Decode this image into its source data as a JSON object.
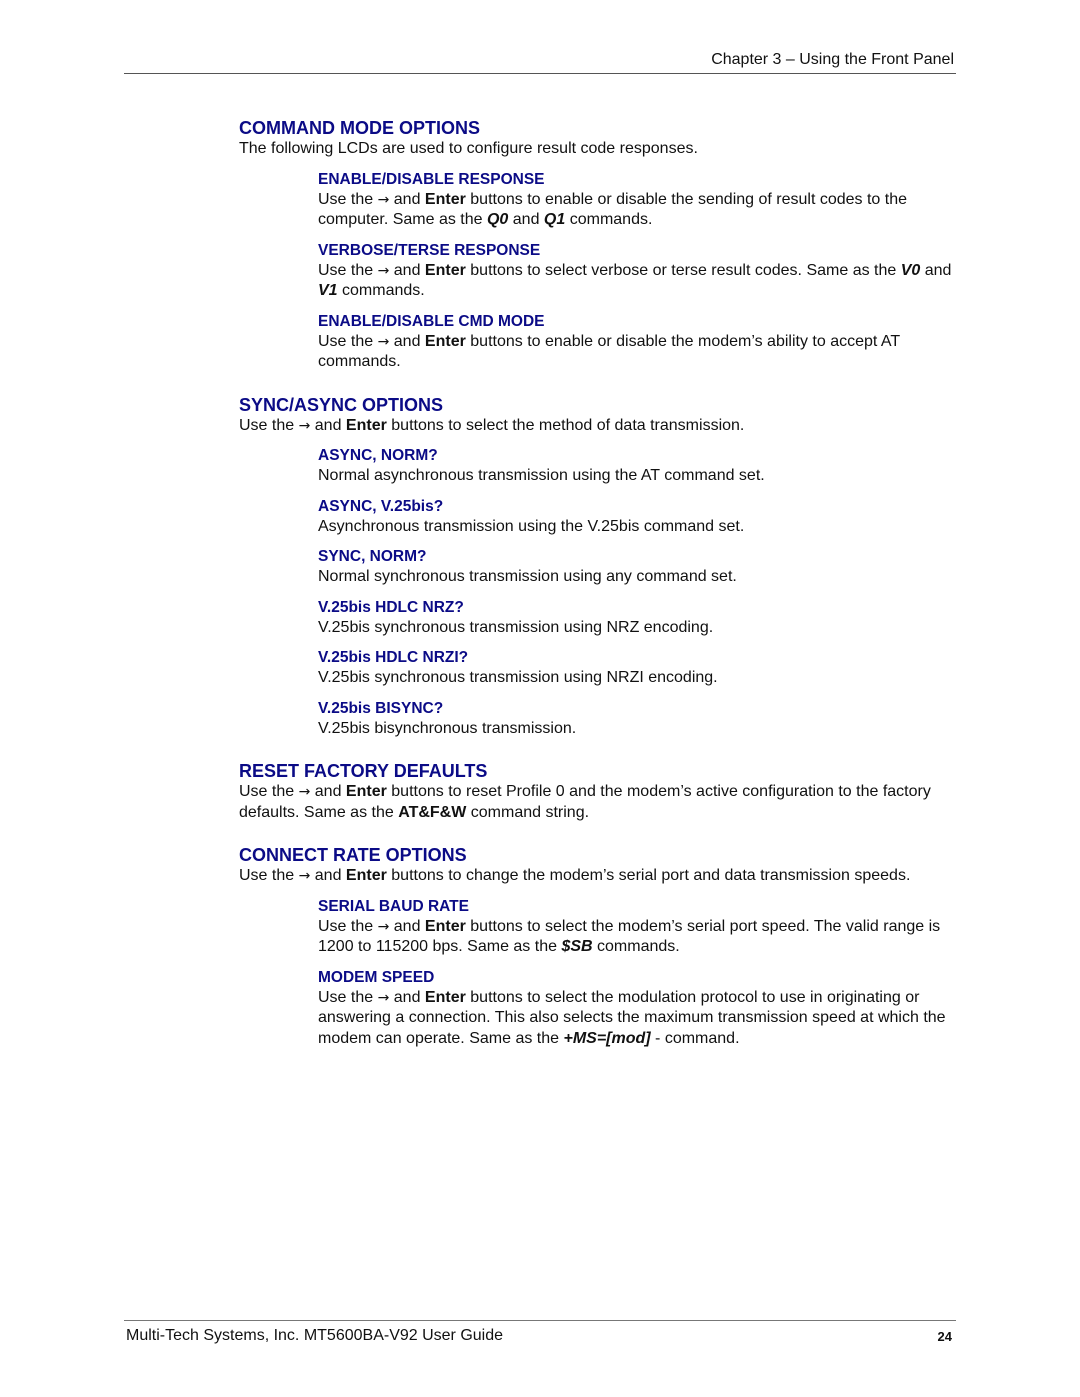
{
  "header": {
    "chapter": "Chapter 3 – Using the Front Panel"
  },
  "sections": {
    "command_mode": {
      "title": "COMMAND MODE OPTIONS",
      "intro": "The following LCDs are used to configure result code responses.",
      "items": [
        {
          "title": "ENABLE/DISABLE RESPONSE",
          "pre": "Use the ",
          "arrow": "→",
          "mid": " and ",
          "bold": "Enter",
          "post": " buttons to enable or disable the sending of result codes to the computer. Same as the ",
          "cmd1": "Q0",
          "and": " and ",
          "cmd2": "Q1",
          "end": " commands."
        },
        {
          "title": "VERBOSE/TERSE RESPONSE",
          "pre": "Use the ",
          "arrow": "→",
          "mid": " and ",
          "bold": "Enter",
          "post": " buttons to select verbose or terse result codes. Same as the ",
          "cmd1": "V0",
          "and": " and ",
          "cmd2": "V1",
          "end": " commands."
        },
        {
          "title": "ENABLE/DISABLE CMD MODE",
          "pre": "Use the ",
          "arrow": "→",
          "mid": " and ",
          "bold": "Enter",
          "post": " buttons to enable or disable the modem’s ability to accept AT commands."
        }
      ]
    },
    "sync_async": {
      "title": "SYNC/ASYNC OPTIONS",
      "pre": "Use the ",
      "arrow": "→",
      "mid": " and ",
      "bold": "Enter",
      "post": " buttons to select the method of data transmission.",
      "items": [
        {
          "title": "ASYNC, NORM?",
          "text": "Normal asynchronous transmission using the AT command set."
        },
        {
          "title": "ASYNC, V.25bis?",
          "text": "Asynchronous transmission using the V.25bis command set."
        },
        {
          "title": "SYNC, NORM?",
          "text": "Normal synchronous transmission using any command set."
        },
        {
          "title": "V.25bis HDLC NRZ?",
          "text": "V.25bis synchronous transmission using NRZ encoding."
        },
        {
          "title": "V.25bis HDLC NRZI?",
          "text": "V.25bis synchronous transmission using NRZI encoding."
        },
        {
          "title": "V.25bis BISYNC?",
          "text": "V.25bis bisynchronous transmission."
        }
      ]
    },
    "reset": {
      "title": "RESET FACTORY DEFAULTS",
      "pre": "Use the ",
      "arrow": "→",
      "mid": " and ",
      "bold": "Enter",
      "post": " buttons to reset Profile 0 and the modem’s active configuration to the factory defaults. Same as the ",
      "cmd": "AT&F&W",
      "end": " command string."
    },
    "connect_rate": {
      "title": "CONNECT RATE OPTIONS",
      "pre": "Use the ",
      "arrow": "→",
      "mid": " and ",
      "bold": "Enter",
      "post": " buttons to change the modem’s serial port and data transmission speeds.",
      "items": [
        {
          "title": "SERIAL BAUD RATE",
          "pre": "Use the ",
          "arrow": "→",
          "mid": " and ",
          "bold": "Enter",
          "post": " buttons to select the modem’s serial port speed. The valid range is 1200 to 115200 bps. Same as the ",
          "cmd": "$SB",
          "end": " commands."
        },
        {
          "title": "MODEM SPEED",
          "pre": "Use the ",
          "arrow": "→",
          "mid": " and ",
          "bold": "Enter",
          "post": " buttons to select the modulation protocol to use in originating or answering a connection. This also selects the maximum transmission speed at which the modem can operate. Same as the ",
          "cmd": "+MS=[mod]",
          "end": " - command."
        }
      ]
    }
  },
  "footer": {
    "guide": "Multi-Tech Systems, Inc. MT5600BA-V92 User Guide",
    "page": "24"
  },
  "colors": {
    "heading": "#0b0b86",
    "text": "#111111",
    "rule": "#555555"
  }
}
